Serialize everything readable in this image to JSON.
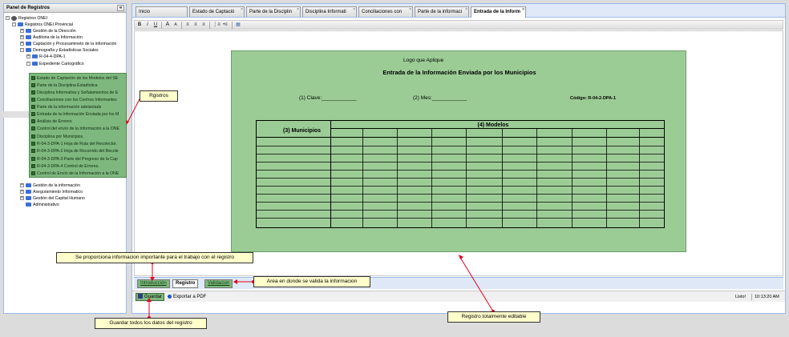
{
  "left_panel": {
    "title": "Panel de Registros",
    "collapse_glyph": "«",
    "tree": {
      "root": "Registros ONEI",
      "provincial": "Registros ONEI Provincial",
      "items": [
        "Gestión de la Dirección",
        "Auditoria de la Información",
        "Captación y Procesamineto de la información",
        "Demografía y Estadísticas Sociales"
      ],
      "r04": "R-04-4-DPA-1",
      "expediente": "Expediente Cartográfico",
      "docs": [
        "Estado de Captación de los Modelos del SE",
        "Parte de la Disciplina Estadística",
        "Disciplina Informativa y Señalamientos de E",
        "Conciliaciones con los Centros Informantes",
        "Parte de la información adelantada",
        "Entrada de la Información Enviada por los M",
        "Análisis de Errores",
        "Control del envío de la Información a la ONE",
        "Disciplina por Municipios.",
        "R-04-3-DPA-1 Hoja de Ruta del Recolector.",
        "R-04-3-DPA-2 Hoja de Recorrido del Recole",
        "R-04-3-DPA-3 Parte del Progreso de la Cap",
        "R-04-3-DPA-4 Control de Errores.",
        "Control de Envío de la Información a la ONE"
      ],
      "after": [
        "Gestión de la información",
        "Aseguramiento Informatico",
        "Gestión del Capital Humano",
        "Administrativo"
      ]
    }
  },
  "tabs": [
    {
      "label": "Inicio"
    },
    {
      "label": "Estado de Captació"
    },
    {
      "label": "Parte de la Disciplin"
    },
    {
      "label": "Disciplina Informati"
    },
    {
      "label": "Conciliaciones con"
    },
    {
      "label": "Parte de la informaci"
    },
    {
      "label": "Entrada de la Inform"
    }
  ],
  "tab_close_glyph": "×",
  "toolbar": {
    "bold": "B",
    "italic": "I",
    "underline": "U",
    "font_grow": "A",
    "font_shrink": "A",
    "align_left": "≡",
    "align_center": "≡",
    "align_right": "≡",
    "ordered_list": "⋮≡",
    "unordered_list": "•≡",
    "source": "▦"
  },
  "document": {
    "logo": "Logo que Aplique",
    "title": "Entrada de la Información Enviada por los Municipios",
    "clave": "(1) Clave:____________",
    "mes": "(2)  Mes:____________",
    "codigo": "Código: R-04-2-DPA-1",
    "col_municipios": "(3) Municipios",
    "col_modelos": "(4) Modelos"
  },
  "bottom_tabs": {
    "introduccion": "Introducción",
    "registro": "Registro",
    "validacion": "Validacion"
  },
  "status": {
    "guardar": "Guardar",
    "exportar": "Exportar a PDF",
    "listo": "Listo!",
    "time": "10:13:20 AM"
  },
  "callouts": {
    "registros": "Rgistros",
    "info": "Se proporciona informacion importante para el trabajo con el registro",
    "validacion": "Area en donde se valida la informacion",
    "guardar": "Guardar todos los datos del registro",
    "editable": "Registro totalmente editable"
  },
  "colors": {
    "green_area": "#9ccc96",
    "green_tab": "#7fb87f",
    "callout_bg": "#ffffcc",
    "arrow": "#e0001a"
  }
}
